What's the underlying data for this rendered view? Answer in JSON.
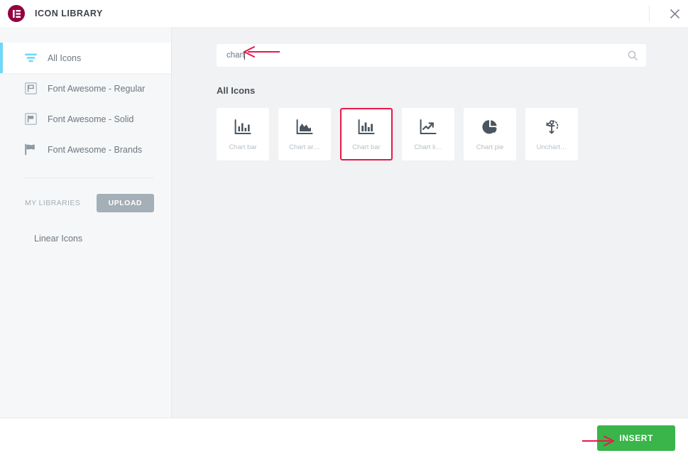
{
  "header": {
    "title": "ICON LIBRARY",
    "logo_icon": "elementor-logo-icon",
    "close_icon": "close-icon",
    "brand_color": "#93003f"
  },
  "sidebar": {
    "items": [
      {
        "label": "All Icons",
        "icon": "filter-icon",
        "active": true
      },
      {
        "label": "Font Awesome - Regular",
        "icon": "flag-outline-icon",
        "active": false
      },
      {
        "label": "Font Awesome - Solid",
        "icon": "flag-solid-icon",
        "active": false
      },
      {
        "label": "Font Awesome - Brands",
        "icon": "flag-wave-icon",
        "active": false
      }
    ],
    "my_libraries_label": "MY LIBRARIES",
    "upload_label": "UPLOAD",
    "custom_library": "Linear Icons",
    "active_accent_color": "#71d7f7"
  },
  "search": {
    "value": "chart",
    "placeholder": "",
    "icon": "search-icon"
  },
  "main": {
    "section_title": "All Icons",
    "selection_color": "#e8184b",
    "icons": [
      {
        "label": "Chart bar",
        "icon": "chart-bar-icon",
        "selected": false
      },
      {
        "label": "Chart ar…",
        "icon": "chart-area-icon",
        "selected": false
      },
      {
        "label": "Chart bar",
        "icon": "chart-bar-solid-icon",
        "selected": true
      },
      {
        "label": "Chart li…",
        "icon": "chart-line-icon",
        "selected": false
      },
      {
        "label": "Chart pie",
        "icon": "chart-pie-icon",
        "selected": false
      },
      {
        "label": "Unchart…",
        "icon": "anchor-uncharted-icon",
        "selected": false
      }
    ]
  },
  "footer": {
    "insert_label": "INSERT",
    "insert_color": "#39b54a"
  },
  "annotations": {
    "arrow_color": "#e8184b",
    "search_arrow": "arrow-left-icon",
    "insert_arrow": "arrow-right-icon"
  }
}
